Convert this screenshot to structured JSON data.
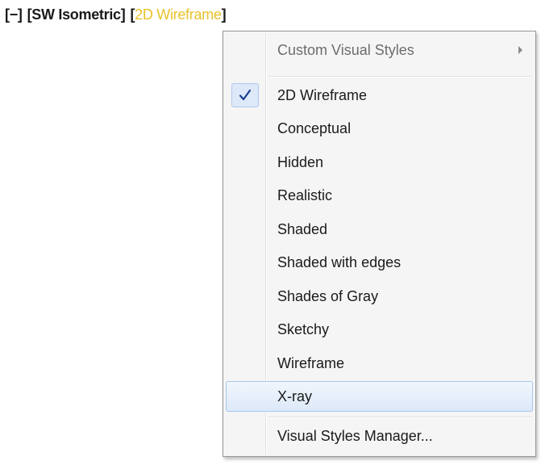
{
  "viewport_controls": {
    "minus": "[−]",
    "view": "[SW Isometric]",
    "style_open": "[",
    "style": "2D Wireframe",
    "style_close": "]",
    "accent_color": "#e8c22a"
  },
  "menu": {
    "custom_visual_styles": "Custom Visual Styles",
    "items": [
      {
        "label": "2D Wireframe",
        "checked": true
      },
      {
        "label": "Conceptual"
      },
      {
        "label": "Hidden"
      },
      {
        "label": "Realistic"
      },
      {
        "label": "Shaded"
      },
      {
        "label": "Shaded with edges"
      },
      {
        "label": "Shades of Gray"
      },
      {
        "label": "Sketchy"
      },
      {
        "label": "Wireframe"
      },
      {
        "label": "X-ray",
        "highlighted": true
      }
    ],
    "manager": "Visual Styles Manager...",
    "check_icon": "checkmark-icon",
    "arrow_icon": "submenu-arrow-icon",
    "highlight_color": "#dde9f9",
    "check_color": "#1b3f91"
  }
}
